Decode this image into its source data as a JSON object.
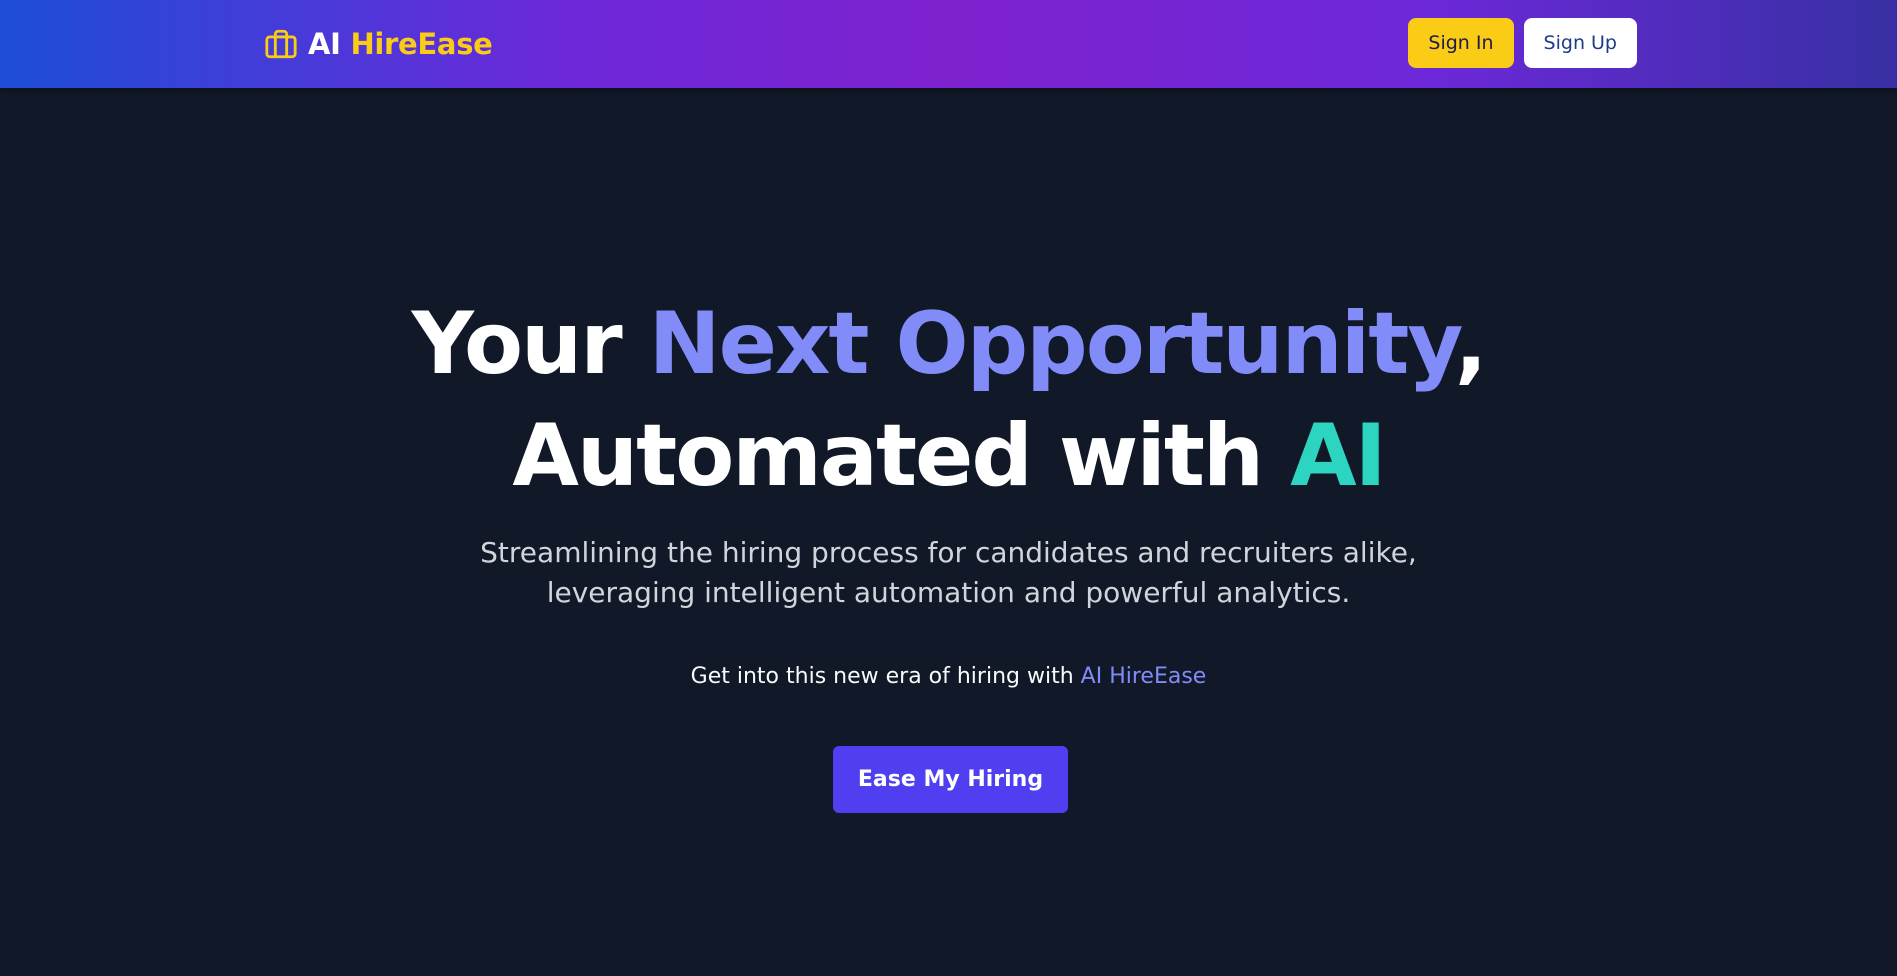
{
  "nav": {
    "brand_ai": "AI",
    "brand_name": "HireEase",
    "brand_icon": "briefcase-icon",
    "signin_label": "Sign In",
    "signup_label": "Sign Up"
  },
  "hero": {
    "title_line1_prefix": "Your ",
    "title_line1_highlight": "Next Opportunity",
    "title_line1_suffix": ",",
    "title_line2_prefix": "Automated with ",
    "title_line2_highlight": "AI",
    "subtitle_line1": "Streamlining the hiring process for candidates and recruiters alike,",
    "subtitle_line2": "leveraging intelligent automation and powerful analytics.",
    "era_text": "Get into this new era of hiring with ",
    "era_brand": "AI HireEase",
    "cta_label": "Ease My Hiring"
  },
  "colors": {
    "accent_yellow": "#facc15",
    "accent_indigo": "#818cf8",
    "accent_teal": "#2dd4bf",
    "cta_bg": "#4f3ff0",
    "page_bg": "#111827"
  }
}
